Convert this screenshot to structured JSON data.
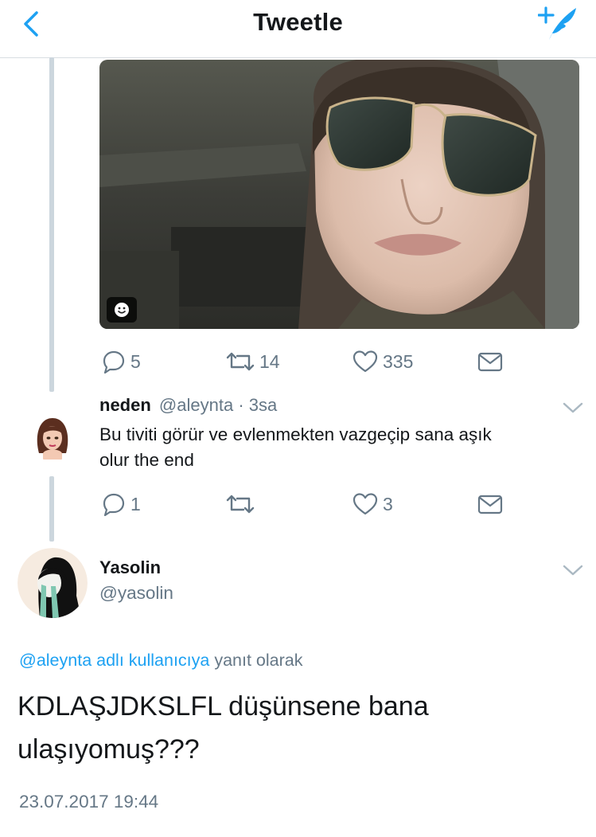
{
  "header": {
    "title": "Tweetle",
    "back_icon": "chevron-left-icon",
    "compose_icon": "compose-tweet-icon",
    "accent": "#1da1f2"
  },
  "first_tweet": {
    "media_badge": "smiley-icon",
    "actions": {
      "replies": "5",
      "retweets": "14",
      "likes": "335"
    }
  },
  "reply_tweet": {
    "name": "neden",
    "handle": "@aleynta",
    "separator": "·",
    "time": "3sa",
    "text_line1": "Bu tiviti görür ve evlenmekten vazgeçip sana aşık",
    "text_line2": "olur the end",
    "actions": {
      "replies": "1",
      "retweets": "",
      "likes": "3"
    }
  },
  "main_tweet": {
    "name": "Yasolin",
    "handle": "@yasolin",
    "reply_to_user": "@aleynta adlı kullanıcıya",
    "reply_to_suffix": "yanıt olarak",
    "text_line1": "KDLAŞJDKSLFL düşünsene bana",
    "text_line2": "ulaşıyomuş???",
    "timestamp": "23.07.2017 19:44"
  }
}
